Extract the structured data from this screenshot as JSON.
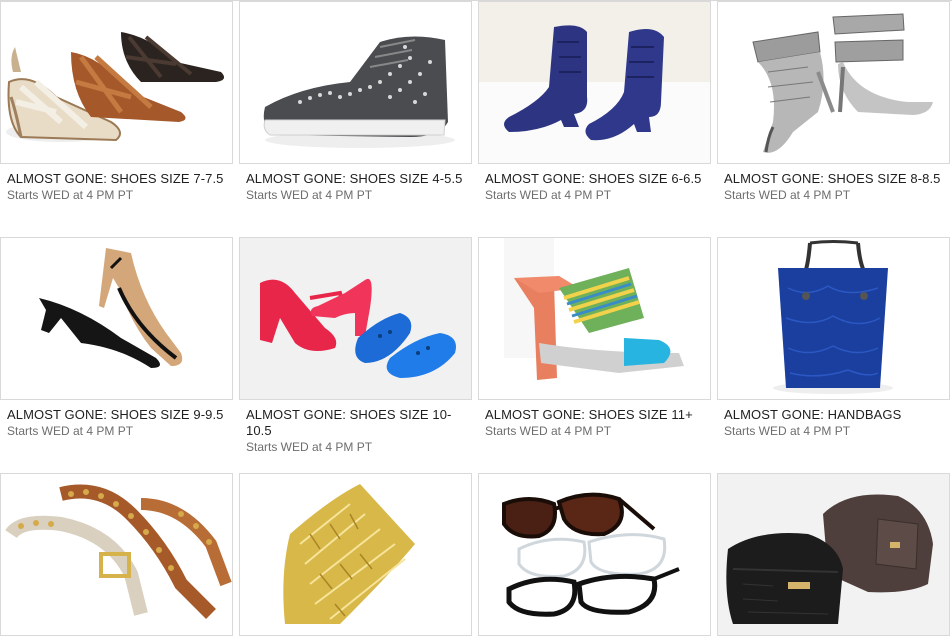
{
  "sales": [
    {
      "title": "ALMOST GONE: SHOES SIZE 7-7.5",
      "start": "Starts WED at 4 PM PT",
      "icon": "sandals-image"
    },
    {
      "title": "ALMOST GONE: SHOES SIZE 4-5.5",
      "start": "Starts WED at 4 PM PT",
      "icon": "studded-sneaker-image"
    },
    {
      "title": "ALMOST GONE: SHOES SIZE 6-6.5",
      "start": "Starts WED at 4 PM PT",
      "icon": "suede-booties-image"
    },
    {
      "title": "ALMOST GONE: SHOES SIZE 8-8.5",
      "start": "Starts WED at 4 PM PT",
      "icon": "snakeskin-heels-image"
    },
    {
      "title": "ALMOST GONE: SHOES SIZE 9-9.5",
      "start": "Starts WED at 4 PM PT",
      "icon": "pumps-image"
    },
    {
      "title": "ALMOST GONE: SHOES SIZE 10-10.5",
      "start": "Starts WED at 4 PM PT",
      "icon": "jelly-shoes-image"
    },
    {
      "title": "ALMOST GONE: SHOES SIZE 11+",
      "start": "Starts WED at 4 PM PT",
      "icon": "beaded-sandal-image"
    },
    {
      "title": "ALMOST GONE: HANDBAGS",
      "start": "Starts WED at 4 PM PT",
      "icon": "blue-tote-image"
    },
    {
      "title": "",
      "start": "",
      "icon": "studded-belts-image"
    },
    {
      "title": "",
      "start": "",
      "icon": "gold-cuff-image"
    },
    {
      "title": "",
      "start": "",
      "icon": "sunglasses-image"
    },
    {
      "title": "",
      "start": "",
      "icon": "leather-clutches-image"
    }
  ],
  "colors": {
    "border": "#d9d9d9",
    "title": "#1f1f1f",
    "subtitle": "#6d6d6d"
  }
}
